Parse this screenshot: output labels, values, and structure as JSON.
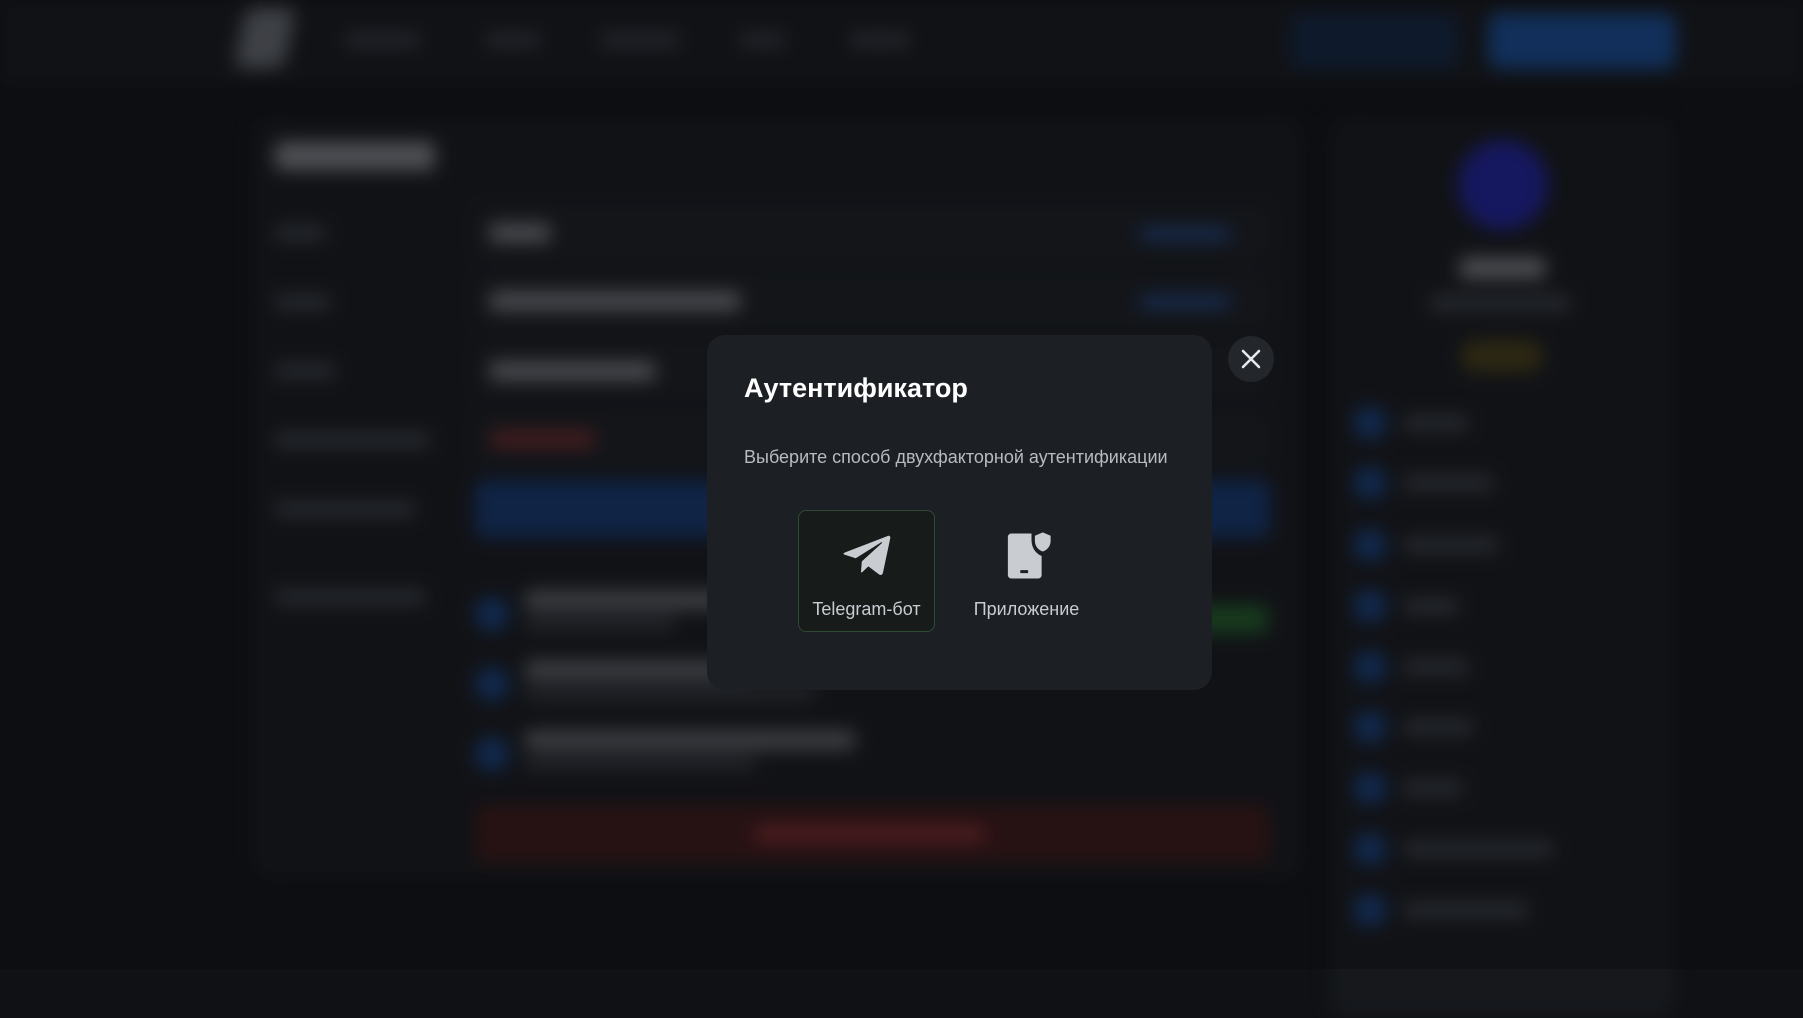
{
  "modal": {
    "title": "Аутентификатор",
    "subtitle": "Выберите способ двухфакторной аутентификации",
    "options": [
      {
        "label": "Telegram-бот",
        "icon": "telegram-icon",
        "selected": true
      },
      {
        "label": "Приложение",
        "icon": "phone-shield-icon",
        "selected": false
      }
    ],
    "close_icon": "close-icon"
  },
  "colors": {
    "page_background": "#0f1114",
    "modal_background": "#1c1f24",
    "selected_border": "#2f4a35",
    "accent_blue": "#1d6fe0"
  }
}
